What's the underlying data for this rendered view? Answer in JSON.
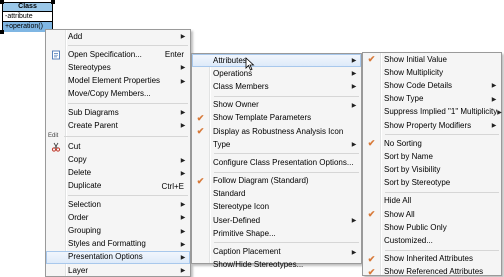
{
  "uml_class": {
    "name": "Class",
    "attribute": "-attribute",
    "operation": "+operation()"
  },
  "menu1": {
    "items": [
      {
        "label": "Add",
        "submenu": true
      },
      {
        "sep": true
      },
      {
        "label": "Open Specification...",
        "shortcut": "Enter",
        "icon": "specification-icon"
      },
      {
        "label": "Stereotypes",
        "submenu": true
      },
      {
        "label": "Model Element Properties",
        "submenu": true
      },
      {
        "label": "Move/Copy Members..."
      },
      {
        "sep": true
      },
      {
        "label": "Sub Diagrams",
        "submenu": true
      },
      {
        "label": "Create Parent",
        "submenu": true
      },
      {
        "section": "Edit"
      },
      {
        "label": "Cut",
        "icon": "scissors-icon"
      },
      {
        "label": "Copy",
        "submenu": true
      },
      {
        "label": "Delete",
        "submenu": true
      },
      {
        "label": "Duplicate",
        "shortcut": "Ctrl+E"
      },
      {
        "sep": true
      },
      {
        "label": "Selection",
        "submenu": true
      },
      {
        "label": "Order",
        "submenu": true
      },
      {
        "label": "Grouping",
        "submenu": true
      },
      {
        "label": "Styles and Formatting",
        "submenu": true
      },
      {
        "label": "Presentation Options",
        "submenu": true,
        "highlight": true
      },
      {
        "label": "Layer",
        "submenu": true
      }
    ]
  },
  "menu2": {
    "items": [
      {
        "label": "Attributes",
        "submenu": true,
        "highlight": true
      },
      {
        "label": "Operations",
        "submenu": true
      },
      {
        "label": "Class Members",
        "submenu": true
      },
      {
        "sep": true
      },
      {
        "label": "Show Owner",
        "submenu": true
      },
      {
        "label": "Show Template Parameters",
        "checked": true
      },
      {
        "label": "Display as Robustness Analysis Icon",
        "checked": true
      },
      {
        "label": "Type",
        "submenu": true
      },
      {
        "sep": true
      },
      {
        "label": "Configure Class Presentation Options..."
      },
      {
        "sep": true
      },
      {
        "label": "Follow Diagram (Standard)",
        "checked": true
      },
      {
        "label": "Standard"
      },
      {
        "label": "Stereotype Icon"
      },
      {
        "label": "User-Defined",
        "submenu": true
      },
      {
        "label": "Primitive Shape..."
      },
      {
        "sep": true
      },
      {
        "label": "Caption Placement",
        "submenu": true
      },
      {
        "label": "Show/Hide Stereotypes..."
      }
    ]
  },
  "menu3": {
    "items": [
      {
        "label": "Show Initial Value",
        "checked": true
      },
      {
        "label": "Show Multiplicity"
      },
      {
        "label": "Show Code Details",
        "submenu": true
      },
      {
        "label": "Show Type",
        "submenu": true
      },
      {
        "label": "Suppress Implied \"1\" Multiplicity",
        "submenu": true
      },
      {
        "label": "Show Property Modifiers",
        "submenu": true
      },
      {
        "sep": true
      },
      {
        "label": "No Sorting",
        "checked": true
      },
      {
        "label": "Sort by Name"
      },
      {
        "label": "Sort by Visibility"
      },
      {
        "label": "Sort by Stereotype"
      },
      {
        "sep": true
      },
      {
        "label": "Hide All"
      },
      {
        "label": "Show All",
        "checked": true
      },
      {
        "label": "Show Public Only"
      },
      {
        "label": "Customized..."
      },
      {
        "sep": true
      },
      {
        "label": "Show Inherited Attributes",
        "checked": true
      },
      {
        "label": "Show Referenced Attributes",
        "checked": true
      }
    ]
  },
  "colors": {
    "uml_header": "#9ac7e8",
    "selected_row": "#7fb6e3",
    "check": "#d87a3a",
    "highlight_border": "#a8c8ec"
  }
}
